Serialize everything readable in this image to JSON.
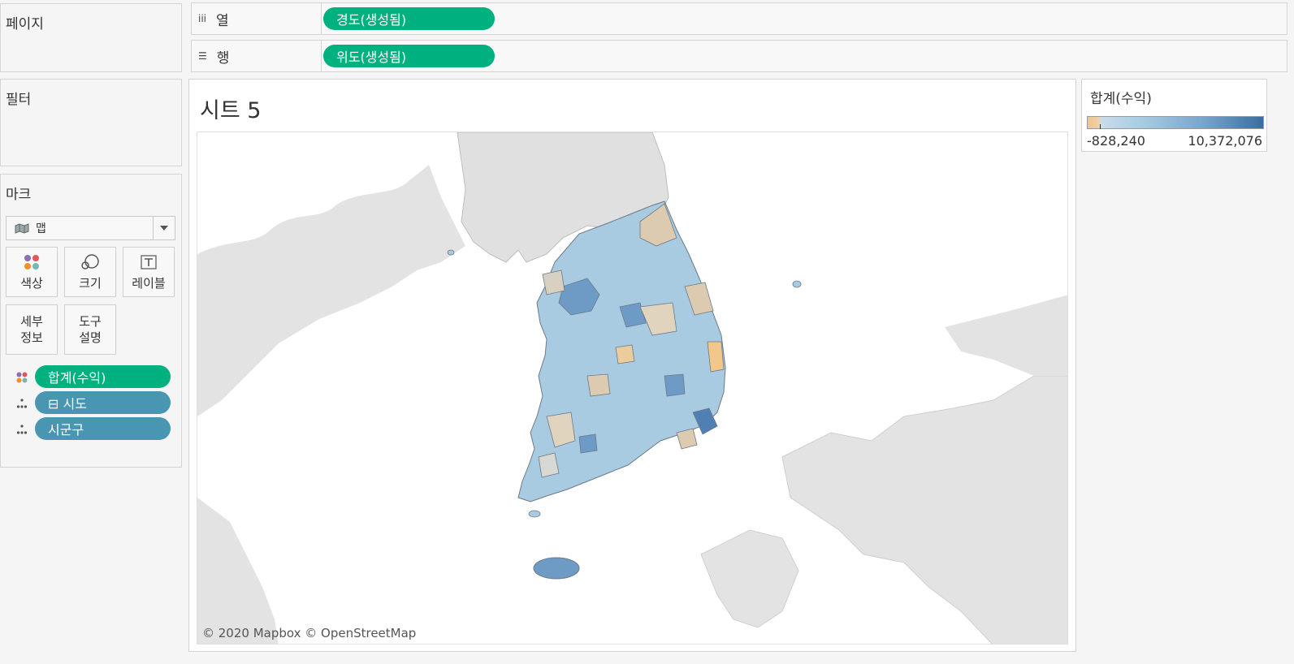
{
  "pages_panel": {
    "title": "페이지"
  },
  "filters_panel": {
    "title": "필터"
  },
  "marks_panel": {
    "title": "마크",
    "mark_type": "맵",
    "mark_type_icon": "map-icon",
    "cards": [
      {
        "label": "색상",
        "icon": "color-icon"
      },
      {
        "label": "크기",
        "icon": "size-icon"
      },
      {
        "label": "레이블",
        "icon": "label-icon"
      },
      {
        "label": "세부\n정보",
        "icon": "detail-icon"
      },
      {
        "label": "도구\n설명",
        "icon": "tooltip-icon"
      }
    ],
    "fields": [
      {
        "label": "합계(수익)",
        "role": "color",
        "color": "#00b180"
      },
      {
        "label": "⊟ 시도",
        "role": "detail",
        "color": "#4996b2"
      },
      {
        "label": "시군구",
        "role": "detail",
        "color": "#4996b2"
      }
    ]
  },
  "columns_shelf": {
    "label": "열",
    "glyph": "iii",
    "pill": "경도(생성됨)"
  },
  "rows_shelf": {
    "label": "행",
    "glyph": "☰",
    "pill": "위도(생성됨)"
  },
  "sheet": {
    "title": "시트 5",
    "credits": "© 2020 Mapbox © OpenStreetMap"
  },
  "legend": {
    "title": "합계(수익)",
    "min": "-828,240",
    "max": "10,372,076",
    "colors": {
      "low": "#f1c48a",
      "mid": "#a8cde3",
      "high": "#3a6ea0"
    }
  }
}
